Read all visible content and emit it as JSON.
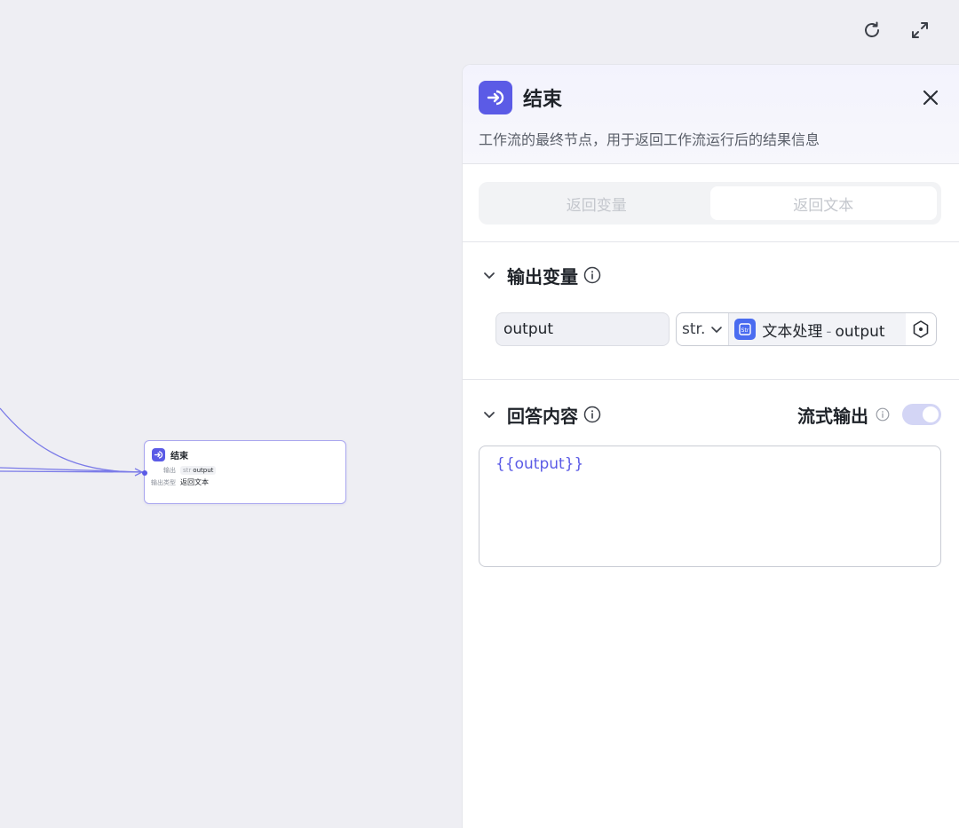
{
  "canvas": {
    "node": {
      "title": "结束",
      "output_label": "输出",
      "output_type": "str",
      "output_name": "output",
      "output_kind_label": "输出类型",
      "output_kind_value": "返回文本"
    }
  },
  "panel": {
    "title": "结束",
    "description": "工作流的最终节点，用于返回工作流运行后的结果信息",
    "tabs": [
      {
        "label": "返回变量",
        "active": false
      },
      {
        "label": "返回文本",
        "active": true
      }
    ],
    "output_section": {
      "title": "输出变量",
      "variable": {
        "name": "output",
        "type": "str.",
        "ref_source": "文本处理",
        "ref_separator": "-",
        "ref_field": "output"
      }
    },
    "answer_section": {
      "title": "回答内容",
      "stream_label": "流式输出",
      "stream_enabled": true,
      "content": "{{output}}"
    }
  },
  "colors": {
    "accent": "#5b5be6",
    "ref_icon": "#4a6cf0",
    "canvas_bg": "#eeeef3"
  }
}
